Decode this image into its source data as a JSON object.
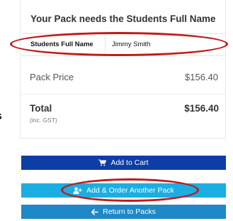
{
  "pack": {
    "title": "Your Pack needs the Students Full Name",
    "name_label": "Students Full Name",
    "name_value": "Jimmy Smith"
  },
  "price": {
    "label": "Pack Price",
    "value": "$156.40"
  },
  "total": {
    "label": "Total",
    "note": "(inc. GST)",
    "value": "$156.40"
  },
  "edge_text": "s",
  "buttons": {
    "add_to_cart": "Add to Cart",
    "add_order_another": "Add & Order Another Pack",
    "return_to_packs": "Return to Packs"
  },
  "icons": {
    "cart": "cart-icon",
    "add_user": "add-user-icon",
    "arrow_left": "arrow-left-icon"
  },
  "colors": {
    "add_to_cart_bg": "#0d3ea5",
    "add_order_bg": "#1aaee3",
    "return_bg": "#1f88c6",
    "highlight_oval": "#c01a1a"
  }
}
